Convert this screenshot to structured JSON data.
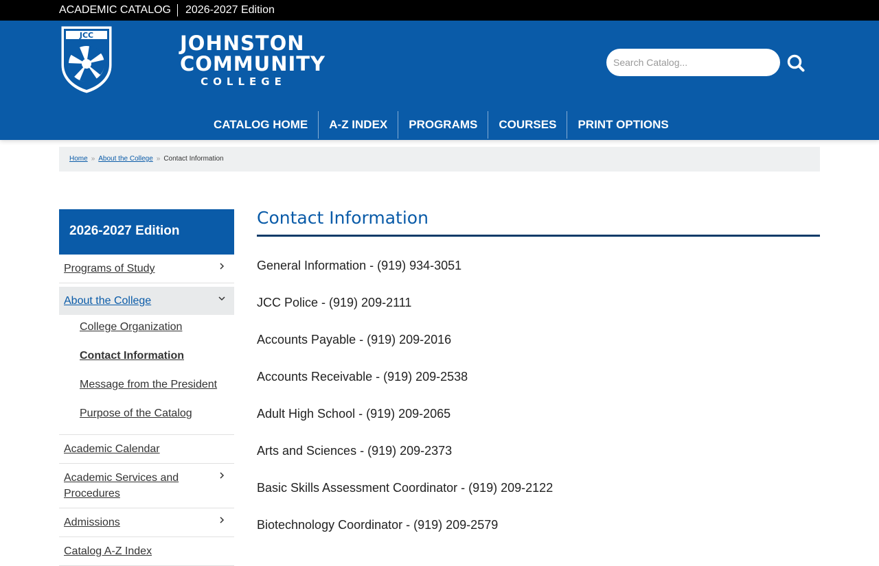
{
  "topbar": {
    "catalog_label": "ACADEMIC CATALOG",
    "edition_label": "2026-2027 Edition"
  },
  "logo": {
    "line1": "JOHNSTON",
    "line2": "COMMUNITY",
    "line3": "COLLEGE",
    "badge_text": "JCC"
  },
  "search": {
    "placeholder": "Search Catalog..."
  },
  "nav": {
    "items": [
      "CATALOG HOME",
      "A-Z INDEX",
      "PROGRAMS",
      "COURSES",
      "PRINT OPTIONS"
    ]
  },
  "breadcrumb": {
    "home": "Home",
    "parent": "About the College",
    "current": "Contact Information"
  },
  "sidebar": {
    "heading": "2026-2027 Edition",
    "items": {
      "programs": "Programs of Study",
      "about": "About the College",
      "calendar": "Academic Calendar",
      "services": "Academic Services and Procedures",
      "admissions": "Admissions",
      "az": "Catalog A-Z Index"
    },
    "sub": [
      "College Organization",
      "Contact Information",
      "Message from the President",
      "Purpose of the Catalog"
    ]
  },
  "main": {
    "title": "Contact Information",
    "contacts": [
      "General Information - (919) 934-3051",
      "JCC Police - (919) 209-2111",
      "Accounts Payable - (919) 209-2016",
      "Accounts Receivable - (919) 209-2538",
      "Adult High School - (919) 209-2065",
      "Arts and Sciences - (919) 209-2373",
      "Basic Skills Assessment Coordinator - (919) 209-2122",
      "Biotechnology Coordinator - (919) 209-2579"
    ]
  },
  "colors": {
    "brand_blue": "#0a5ba8",
    "topbar": "#000000",
    "rule": "#0b3a68"
  }
}
